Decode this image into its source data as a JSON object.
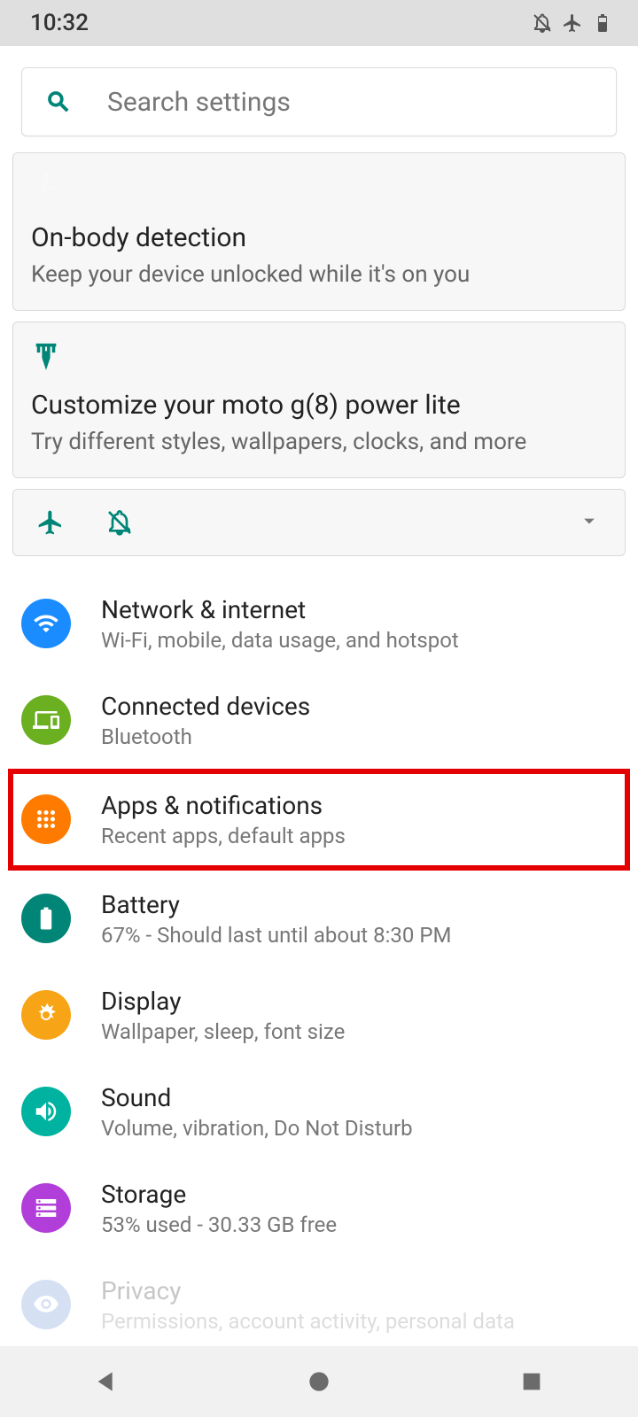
{
  "status": {
    "time": "10:32"
  },
  "search": {
    "placeholder": "Search settings"
  },
  "cards": {
    "onbody": {
      "title": "On-body detection",
      "sub": "Keep your device unlocked while it's on you"
    },
    "customize": {
      "title": "Customize your moto g(8) power lite",
      "sub": "Try different styles, wallpapers, clocks, and more"
    }
  },
  "items": [
    {
      "title": "Network & internet",
      "sub": "Wi-Fi, mobile, data usage, and hotspot",
      "color": "#1a8cff",
      "icon": "wifi"
    },
    {
      "title": "Connected devices",
      "sub": "Bluetooth",
      "color": "#6bb020",
      "icon": "devices"
    },
    {
      "title": "Apps & notifications",
      "sub": "Recent apps, default apps",
      "color": "#ff7b00",
      "icon": "apps",
      "highlight": true
    },
    {
      "title": "Battery",
      "sub": "67% - Should last until about 8:30 PM",
      "color": "#008577",
      "icon": "battery"
    },
    {
      "title": "Display",
      "sub": "Wallpaper, sleep, font size",
      "color": "#f7a516",
      "icon": "display"
    },
    {
      "title": "Sound",
      "sub": "Volume, vibration, Do Not Disturb",
      "color": "#00b3a0",
      "icon": "sound"
    },
    {
      "title": "Storage",
      "sub": "53% used - 30.33 GB free",
      "color": "#b23ed9",
      "icon": "storage"
    },
    {
      "title": "Privacy",
      "sub": "Permissions, account activity, personal data",
      "color": "#5a8cd1",
      "icon": "privacy",
      "fade": true
    }
  ]
}
